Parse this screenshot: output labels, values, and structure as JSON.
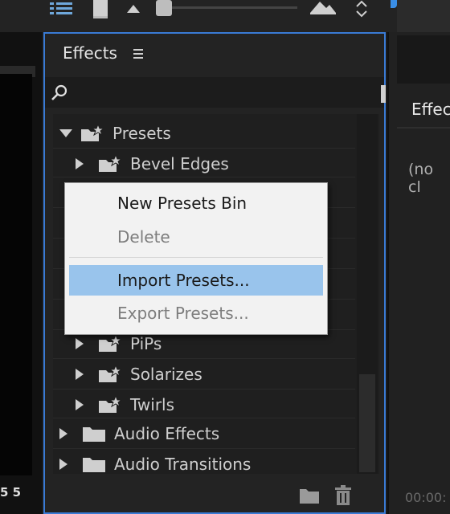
{
  "effects_panel": {
    "title": "Effects",
    "tree": [
      {
        "label": "Presets",
        "level": 0,
        "expanded": true,
        "icon": "preset-folder-icon"
      },
      {
        "label": "Bevel Edges",
        "level": 1,
        "expanded": false,
        "icon": "preset-folder-icon"
      },
      {
        "label": "PiPs",
        "level": 1,
        "expanded": false,
        "icon": "preset-folder-icon"
      },
      {
        "label": "Solarizes",
        "level": 1,
        "expanded": false,
        "icon": "preset-folder-icon"
      },
      {
        "label": "Twirls",
        "level": 1,
        "expanded": false,
        "icon": "preset-folder-icon"
      },
      {
        "label": "Audio Effects",
        "level": 0,
        "expanded": false,
        "icon": "folder-icon"
      },
      {
        "label": "Audio Transitions",
        "level": 0,
        "expanded": false,
        "icon": "folder-icon"
      }
    ]
  },
  "context_menu": {
    "items": [
      {
        "label": "New Presets Bin",
        "enabled": true,
        "highlighted": false
      },
      {
        "label": "Delete",
        "enabled": false,
        "highlighted": false
      },
      {
        "label": "Import Presets...",
        "enabled": true,
        "highlighted": true
      },
      {
        "label": "Export Presets...",
        "enabled": false,
        "highlighted": false
      }
    ]
  },
  "right_panel": {
    "tab_label": "Effec",
    "no_clip_text": "(no cl",
    "timecode": "00:00:"
  },
  "left_column": {
    "frame_numbers": "5  5"
  },
  "colors": {
    "accent": "#3a7bd5",
    "menu_highlight": "#99c4ec",
    "panel_bg": "#232323"
  }
}
